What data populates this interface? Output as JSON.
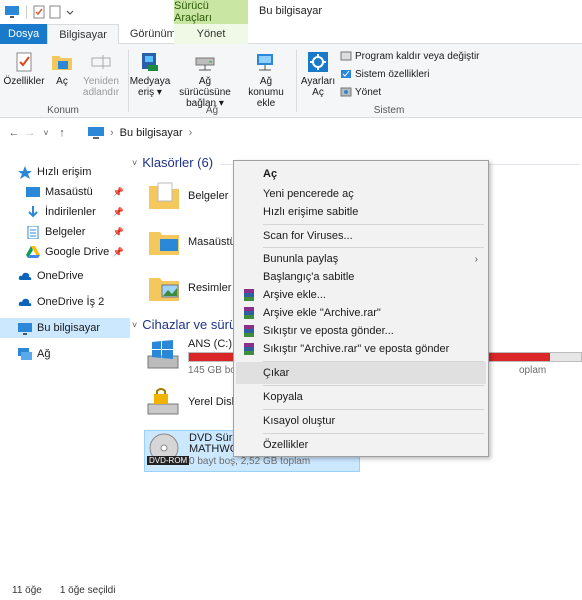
{
  "titlebar": {
    "context_group": "Sürücü Araçları",
    "title": "Bu bilgisayar"
  },
  "tabs": {
    "file": "Dosya",
    "computer": "Bilgisayar",
    "view": "Görünüm",
    "manage": "Yönet"
  },
  "ribbon": {
    "properties": "Özellikler",
    "open": "Aç",
    "rename_line1": "Yeniden",
    "rename_line2": "adlandır",
    "location_group": "Konum",
    "media_line1": "Medyaya",
    "media_line2": "eriş",
    "map_drive_line1": "Ağ sürücüsüne",
    "map_drive_line2": "bağlan",
    "add_network_line1": "Ağ konumu",
    "add_network_line2": "ekle",
    "network_group": "Ağ",
    "settings_line1": "Ayarları",
    "settings_line2": "Aç",
    "uninstall": "Program kaldır veya değiştir",
    "system_props": "Sistem özellikleri",
    "manage": "Yönet",
    "system_group": "Sistem"
  },
  "address": {
    "location": "Bu bilgisayar"
  },
  "sidebar": {
    "quick_access": "Hızlı erişim",
    "desktop": "Masaüstü",
    "downloads": "İndirilenler",
    "documents": "Belgeler",
    "google_drive": "Google Drive",
    "onedrive": "OneDrive",
    "onedrive_work": "OneDrive İş 2",
    "this_pc": "Bu bilgisayar",
    "network": "Ağ"
  },
  "main": {
    "folders_title": "Klasörler (6)",
    "folders": [
      "Belgeler",
      "Masaüstü",
      "Resimler"
    ],
    "devices_title": "Cihazlar ve sürücü",
    "drive_c_name": "ANS (C:)",
    "drive_c_sub": "145 GB boş",
    "drive_c_tail": "oplam",
    "drive_c_fill": 0.92,
    "local_disk_name": "Yerel Disk (",
    "dvd_name_line1": "DVD Sürüc",
    "dvd_name_line2": "MATHWO",
    "dvd_badge": "DVD-ROM",
    "dvd_sub": "0 bayt boş, 2,52 GB toplam"
  },
  "context_menu": {
    "open": "Aç",
    "open_new_window": "Yeni pencerede aç",
    "pin_quick": "Hızlı erişime sabitle",
    "scan": "Scan for Viruses...",
    "share": "Bununla paylaş",
    "pin_start": "Başlangıç'a sabitle",
    "add_archive": "Arşive ekle...",
    "add_archive_rar": "Arşive ekle \"Archive.rar\"",
    "compress_email": "Sıkıştır ve eposta gönder...",
    "compress_rar_email": "Sıkıştır \"Archive.rar\" ve eposta gönder",
    "eject": "Çıkar",
    "copy": "Kopyala",
    "create_shortcut": "Kısayol oluştur",
    "properties": "Özellikler"
  },
  "status": {
    "items": "11 öğe",
    "selected": "1 öğe seçildi"
  },
  "colors": {
    "accent": "#1979ca",
    "context_tab": "#c9e6a3",
    "selection": "#cce8ff",
    "drive_full": "#da2626"
  }
}
